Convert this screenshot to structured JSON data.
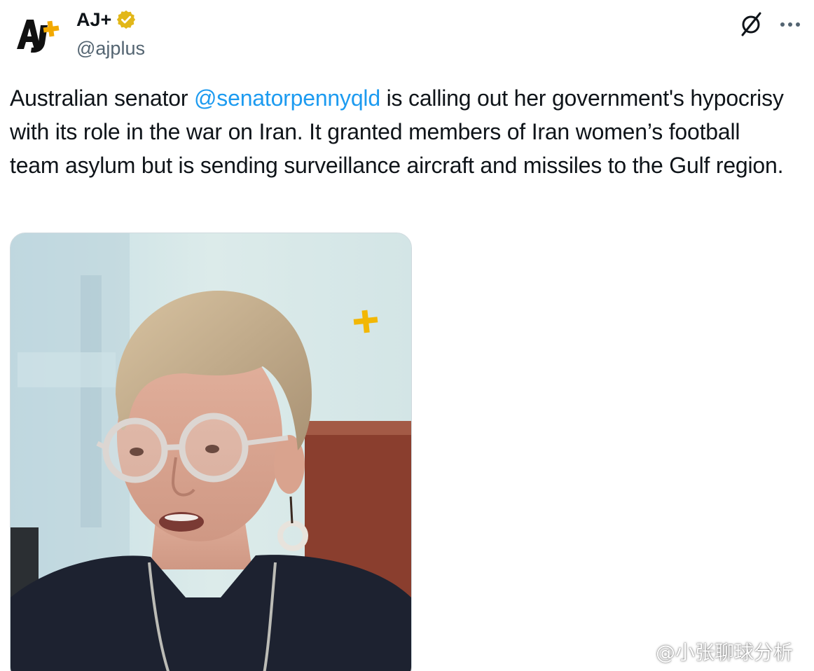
{
  "post": {
    "author": {
      "name": "AJ+",
      "handle": "@ajplus",
      "verified_color": "#e2b719"
    },
    "text": {
      "before_mention": "Australian senator ",
      "mention": "@senatorpennyqld",
      "after_mention": " is calling out her government's hypocrisy with its role in the war on Iran. It granted members of Iran women’s football team asylum but is sending surveillance aircraft and missiles to the Gulf region."
    },
    "media": {
      "logo_mark": "+"
    },
    "actions": {
      "grok_icon": "slashed-circle-icon",
      "more_icon": "ellipsis-icon"
    }
  },
  "watermark": {
    "text": "@小张聊球分析"
  },
  "colors": {
    "link": "#1d9bf0",
    "handle_gray": "#536471",
    "text": "#0f1419"
  }
}
